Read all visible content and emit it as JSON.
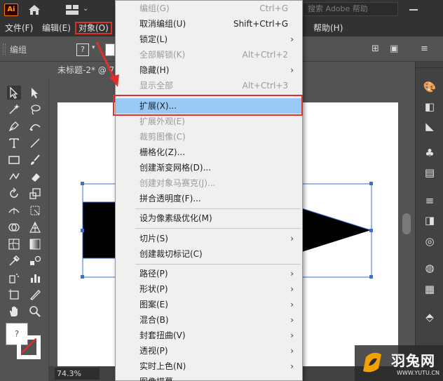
{
  "titlebar": {
    "logo": "Ai",
    "search_placeholder": "搜索 Adobe 帮助"
  },
  "menubar": {
    "items": [
      {
        "label": "文件(F)"
      },
      {
        "label": "编辑(E)"
      },
      {
        "label": "对象(O)"
      },
      {
        "label": "帮助(H)"
      }
    ]
  },
  "controlbar": {
    "selection_label": "编组",
    "fill_unknown": "?"
  },
  "document": {
    "tab_label": "未标题-2* @ 7",
    "zoom": "74.3%"
  },
  "object_menu": {
    "items": [
      {
        "label": "编组(G)",
        "shortcut": "Ctrl+G",
        "disabled": true
      },
      {
        "label": "取消编组(U)",
        "shortcut": "Shift+Ctrl+G"
      },
      {
        "label": "锁定(L)",
        "submenu": true
      },
      {
        "label": "全部解锁(K)",
        "shortcut": "Alt+Ctrl+2",
        "disabled": true
      },
      {
        "label": "隐藏(H)",
        "submenu": true
      },
      {
        "label": "显示全部",
        "shortcut": "Alt+Ctrl+3",
        "disabled": true
      },
      {
        "label": "扩展(X)...",
        "highlight": true
      },
      {
        "label": "扩展外观(E)",
        "disabled": true
      },
      {
        "label": "裁剪图像(C)",
        "disabled": true
      },
      {
        "label": "栅格化(Z)..."
      },
      {
        "label": "创建渐变网格(D)..."
      },
      {
        "label": "创建对象马赛克(J)...",
        "disabled": true
      },
      {
        "label": "拼合透明度(F)..."
      },
      {
        "label": "设为像素级优化(M)"
      },
      {
        "label": "切片(S)",
        "submenu": true
      },
      {
        "label": "创建裁切标记(C)"
      },
      {
        "label": "路径(P)",
        "submenu": true
      },
      {
        "label": "形状(P)",
        "submenu": true
      },
      {
        "label": "图案(E)",
        "submenu": true
      },
      {
        "label": "混合(B)",
        "submenu": true
      },
      {
        "label": "封套扭曲(V)",
        "submenu": true
      },
      {
        "label": "透视(P)",
        "submenu": true
      },
      {
        "label": "实时上色(N)",
        "submenu": true
      },
      {
        "label": "图像描摹",
        "submenu": true
      }
    ],
    "arrow_glyph": "›"
  },
  "watermark": {
    "name": "羽兔网",
    "url": "WWW.YUTU.CN"
  },
  "colors": {
    "highlight": "#99c9f5",
    "annotation_red": "#e0302b",
    "ui_dark": "#323232",
    "ui_mid": "#535353"
  }
}
